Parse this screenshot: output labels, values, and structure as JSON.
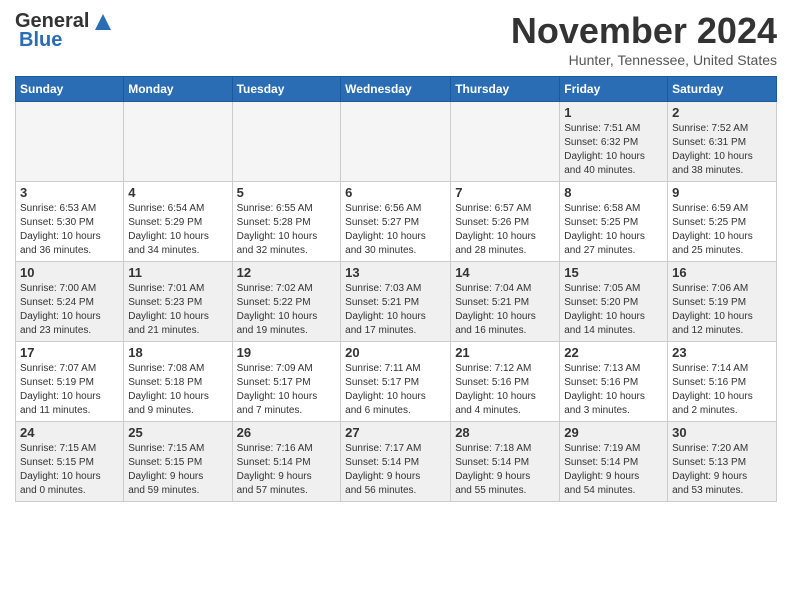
{
  "header": {
    "logo_general": "General",
    "logo_blue": "Blue",
    "month_title": "November 2024",
    "location": "Hunter, Tennessee, United States"
  },
  "calendar": {
    "days_of_week": [
      "Sunday",
      "Monday",
      "Tuesday",
      "Wednesday",
      "Thursday",
      "Friday",
      "Saturday"
    ],
    "rows": [
      [
        {
          "day": "",
          "info": ""
        },
        {
          "day": "",
          "info": ""
        },
        {
          "day": "",
          "info": ""
        },
        {
          "day": "",
          "info": ""
        },
        {
          "day": "",
          "info": ""
        },
        {
          "day": "1",
          "info": "Sunrise: 7:51 AM\nSunset: 6:32 PM\nDaylight: 10 hours\nand 40 minutes."
        },
        {
          "day": "2",
          "info": "Sunrise: 7:52 AM\nSunset: 6:31 PM\nDaylight: 10 hours\nand 38 minutes."
        }
      ],
      [
        {
          "day": "3",
          "info": "Sunrise: 6:53 AM\nSunset: 5:30 PM\nDaylight: 10 hours\nand 36 minutes."
        },
        {
          "day": "4",
          "info": "Sunrise: 6:54 AM\nSunset: 5:29 PM\nDaylight: 10 hours\nand 34 minutes."
        },
        {
          "day": "5",
          "info": "Sunrise: 6:55 AM\nSunset: 5:28 PM\nDaylight: 10 hours\nand 32 minutes."
        },
        {
          "day": "6",
          "info": "Sunrise: 6:56 AM\nSunset: 5:27 PM\nDaylight: 10 hours\nand 30 minutes."
        },
        {
          "day": "7",
          "info": "Sunrise: 6:57 AM\nSunset: 5:26 PM\nDaylight: 10 hours\nand 28 minutes."
        },
        {
          "day": "8",
          "info": "Sunrise: 6:58 AM\nSunset: 5:25 PM\nDaylight: 10 hours\nand 27 minutes."
        },
        {
          "day": "9",
          "info": "Sunrise: 6:59 AM\nSunset: 5:25 PM\nDaylight: 10 hours\nand 25 minutes."
        }
      ],
      [
        {
          "day": "10",
          "info": "Sunrise: 7:00 AM\nSunset: 5:24 PM\nDaylight: 10 hours\nand 23 minutes."
        },
        {
          "day": "11",
          "info": "Sunrise: 7:01 AM\nSunset: 5:23 PM\nDaylight: 10 hours\nand 21 minutes."
        },
        {
          "day": "12",
          "info": "Sunrise: 7:02 AM\nSunset: 5:22 PM\nDaylight: 10 hours\nand 19 minutes."
        },
        {
          "day": "13",
          "info": "Sunrise: 7:03 AM\nSunset: 5:21 PM\nDaylight: 10 hours\nand 17 minutes."
        },
        {
          "day": "14",
          "info": "Sunrise: 7:04 AM\nSunset: 5:21 PM\nDaylight: 10 hours\nand 16 minutes."
        },
        {
          "day": "15",
          "info": "Sunrise: 7:05 AM\nSunset: 5:20 PM\nDaylight: 10 hours\nand 14 minutes."
        },
        {
          "day": "16",
          "info": "Sunrise: 7:06 AM\nSunset: 5:19 PM\nDaylight: 10 hours\nand 12 minutes."
        }
      ],
      [
        {
          "day": "17",
          "info": "Sunrise: 7:07 AM\nSunset: 5:19 PM\nDaylight: 10 hours\nand 11 minutes."
        },
        {
          "day": "18",
          "info": "Sunrise: 7:08 AM\nSunset: 5:18 PM\nDaylight: 10 hours\nand 9 minutes."
        },
        {
          "day": "19",
          "info": "Sunrise: 7:09 AM\nSunset: 5:17 PM\nDaylight: 10 hours\nand 7 minutes."
        },
        {
          "day": "20",
          "info": "Sunrise: 7:11 AM\nSunset: 5:17 PM\nDaylight: 10 hours\nand 6 minutes."
        },
        {
          "day": "21",
          "info": "Sunrise: 7:12 AM\nSunset: 5:16 PM\nDaylight: 10 hours\nand 4 minutes."
        },
        {
          "day": "22",
          "info": "Sunrise: 7:13 AM\nSunset: 5:16 PM\nDaylight: 10 hours\nand 3 minutes."
        },
        {
          "day": "23",
          "info": "Sunrise: 7:14 AM\nSunset: 5:16 PM\nDaylight: 10 hours\nand 2 minutes."
        }
      ],
      [
        {
          "day": "24",
          "info": "Sunrise: 7:15 AM\nSunset: 5:15 PM\nDaylight: 10 hours\nand 0 minutes."
        },
        {
          "day": "25",
          "info": "Sunrise: 7:15 AM\nSunset: 5:15 PM\nDaylight: 9 hours\nand 59 minutes."
        },
        {
          "day": "26",
          "info": "Sunrise: 7:16 AM\nSunset: 5:14 PM\nDaylight: 9 hours\nand 57 minutes."
        },
        {
          "day": "27",
          "info": "Sunrise: 7:17 AM\nSunset: 5:14 PM\nDaylight: 9 hours\nand 56 minutes."
        },
        {
          "day": "28",
          "info": "Sunrise: 7:18 AM\nSunset: 5:14 PM\nDaylight: 9 hours\nand 55 minutes."
        },
        {
          "day": "29",
          "info": "Sunrise: 7:19 AM\nSunset: 5:14 PM\nDaylight: 9 hours\nand 54 minutes."
        },
        {
          "day": "30",
          "info": "Sunrise: 7:20 AM\nSunset: 5:13 PM\nDaylight: 9 hours\nand 53 minutes."
        }
      ]
    ]
  }
}
